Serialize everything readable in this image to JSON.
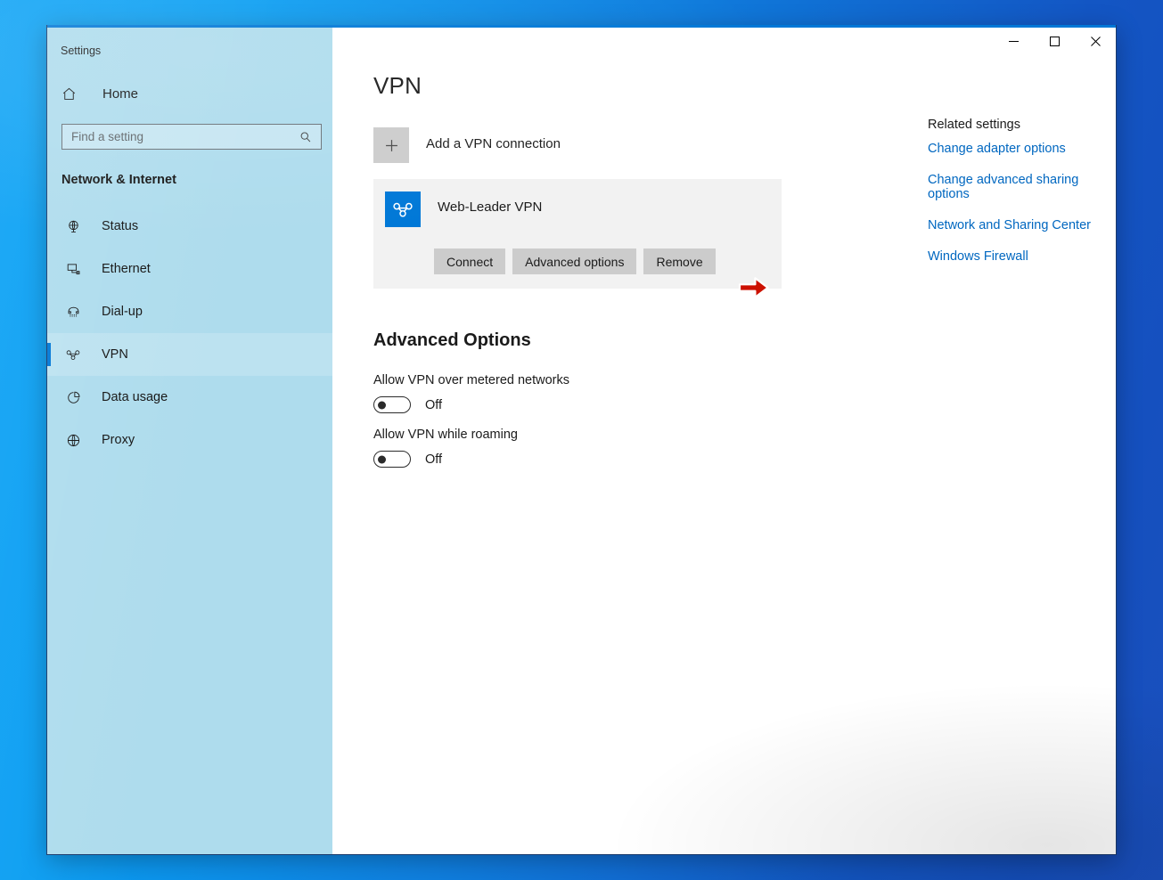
{
  "window": {
    "app_title": "Settings",
    "caption": {
      "minimize": "–",
      "maximize": "☐",
      "close": "✕",
      "minimize_name": "minimize",
      "maximize_name": "maximize",
      "close_name": "close"
    }
  },
  "sidebar": {
    "home_label": "Home",
    "home_icon": "home-icon",
    "search": {
      "placeholder": "Find a setting",
      "value": "",
      "icon": "search-icon"
    },
    "section_title": "Network & Internet",
    "items": [
      {
        "label": "Status",
        "icon": "status-globe-icon",
        "selected": false
      },
      {
        "label": "Ethernet",
        "icon": "ethernet-icon",
        "selected": false
      },
      {
        "label": "Dial-up",
        "icon": "dial-up-phone-icon",
        "selected": false
      },
      {
        "label": "VPN",
        "icon": "vpn-knot-icon",
        "selected": true
      },
      {
        "label": "Data usage",
        "icon": "pie-chart-icon",
        "selected": false
      },
      {
        "label": "Proxy",
        "icon": "globe-icon",
        "selected": false
      }
    ]
  },
  "main": {
    "page_title": "VPN",
    "add_connection": {
      "label": "Add a VPN connection",
      "icon": "plus-icon"
    },
    "connection": {
      "name": "Web-Leader VPN",
      "icon": "vpn-knot-icon",
      "buttons": [
        {
          "label": "Connect"
        },
        {
          "label": "Advanced options"
        },
        {
          "label": "Remove"
        }
      ],
      "annotation_icon": "red-arrow-icon"
    },
    "advanced": {
      "title": "Advanced Options",
      "options": [
        {
          "label": "Allow VPN over metered networks",
          "state": "Off"
        },
        {
          "label": "Allow VPN while roaming",
          "state": "Off"
        }
      ]
    }
  },
  "aside": {
    "title": "Related settings",
    "links": [
      {
        "label": "Change adapter options"
      },
      {
        "label": "Change advanced sharing options"
      },
      {
        "label": "Network and Sharing Center"
      },
      {
        "label": "Windows Firewall"
      }
    ]
  },
  "colors": {
    "accent": "#0078d7",
    "link": "#0067c0",
    "sidebar": "#aedced",
    "card": "#f2f2f2",
    "button": "#cccccc",
    "annotation_red": "#cc1100"
  }
}
